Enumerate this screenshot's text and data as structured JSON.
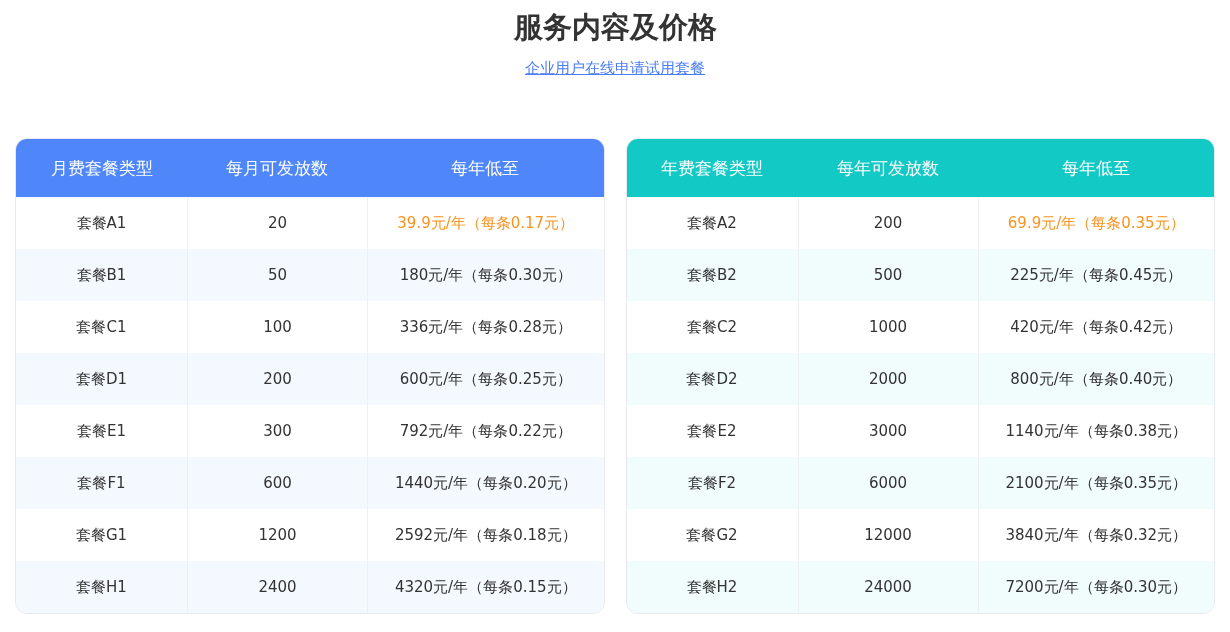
{
  "title": "服务内容及价格",
  "link": "企业用户在线申请试用套餐",
  "tables": [
    {
      "color": "#4f87fb",
      "columns": [
        "月费套餐类型",
        "每月可发放数",
        "每年低至"
      ],
      "rows": [
        {
          "cells": [
            "套餐A1",
            "20",
            "39.9元/年（每条0.17元）"
          ],
          "highlighted": true
        },
        {
          "cells": [
            "套餐B1",
            "50",
            "180元/年（每条0.30元）"
          ],
          "highlighted": false
        },
        {
          "cells": [
            "套餐C1",
            "100",
            "336元/年（每条0.28元）"
          ],
          "highlighted": false
        },
        {
          "cells": [
            "套餐D1",
            "200",
            "600元/年（每条0.25元）"
          ],
          "highlighted": false
        },
        {
          "cells": [
            "套餐E1",
            "300",
            "792元/年（每条0.22元）"
          ],
          "highlighted": false
        },
        {
          "cells": [
            "套餐F1",
            "600",
            "1440元/年（每条0.20元）"
          ],
          "highlighted": false
        },
        {
          "cells": [
            "套餐G1",
            "1200",
            "2592元/年（每条0.18元）"
          ],
          "highlighted": false
        },
        {
          "cells": [
            "套餐H1",
            "2400",
            "4320元/年（每条0.15元）"
          ],
          "highlighted": false
        }
      ]
    },
    {
      "color": "#13c9c6",
      "columns": [
        "年费套餐类型",
        "每年可发放数",
        "每年低至"
      ],
      "rows": [
        {
          "cells": [
            "套餐A2",
            "200",
            "69.9元/年（每条0.35元）"
          ],
          "highlighted": true
        },
        {
          "cells": [
            "套餐B2",
            "500",
            "225元/年（每条0.45元）"
          ],
          "highlighted": false
        },
        {
          "cells": [
            "套餐C2",
            "1000",
            "420元/年（每条0.42元）"
          ],
          "highlighted": false
        },
        {
          "cells": [
            "套餐D2",
            "2000",
            "800元/年（每条0.40元）"
          ],
          "highlighted": false
        },
        {
          "cells": [
            "套餐E2",
            "3000",
            "1140元/年（每条0.38元）"
          ],
          "highlighted": false
        },
        {
          "cells": [
            "套餐F2",
            "6000",
            "2100元/年（每条0.35元）"
          ],
          "highlighted": false
        },
        {
          "cells": [
            "套餐G2",
            "12000",
            "3840元/年（每条0.32元）"
          ],
          "highlighted": false
        },
        {
          "cells": [
            "套餐H2",
            "24000",
            "7200元/年（每条0.30元）"
          ],
          "highlighted": false
        }
      ]
    }
  ]
}
